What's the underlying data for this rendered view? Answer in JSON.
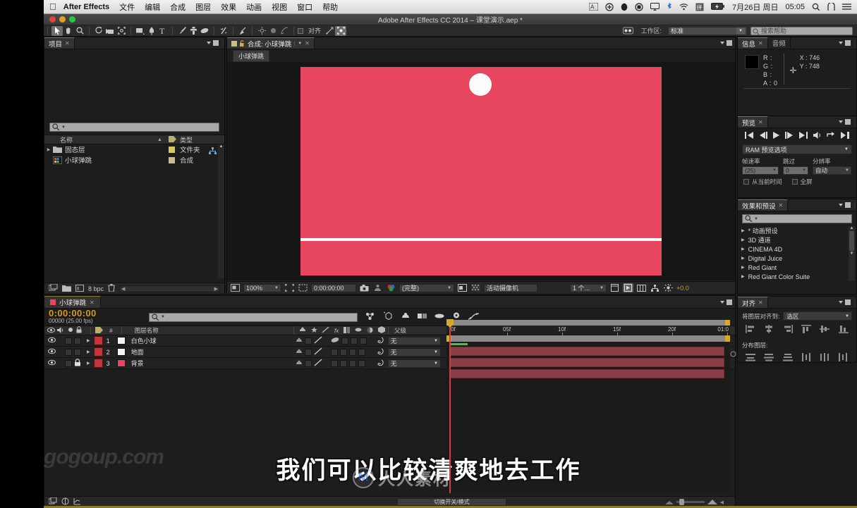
{
  "menubar": {
    "apple": "apple-logo",
    "app_name": "After Effects",
    "items": [
      "文件",
      "编辑",
      "合成",
      "图层",
      "效果",
      "动画",
      "视图",
      "窗口",
      "帮助"
    ],
    "status_icons": [
      "text-input-icon",
      "plus-circle-icon",
      "qq-icon",
      "record-icon",
      "airplay-icon",
      "bluetooth-icon",
      "wifi-icon",
      "input-source-icon",
      "battery-icon"
    ],
    "date": "7月26日 周日",
    "time": "05:05",
    "search_icon": "search-icon",
    "notification_icon": "notification-center-icon"
  },
  "titlebar": {
    "title": "Adobe After Effects CC 2014 – 课堂演示.aep *"
  },
  "toolbar": {
    "tools": [
      "selection-tool",
      "hand-tool",
      "zoom-tool",
      "rotation-tool",
      "camera-tool",
      "pan-behind-tool",
      "shape-tool",
      "pen-tool",
      "text-tool",
      "brush-tool",
      "clone-stamp-tool",
      "eraser-tool",
      "roto-brush-tool",
      "puppet-pin-tool"
    ],
    "align_label": "对齐",
    "workspace_label": "工作区:",
    "workspace_value": "标准",
    "help_placeholder": "搜索帮助"
  },
  "project": {
    "tab": "项目",
    "search_placeholder": "",
    "columns": {
      "name": "名称",
      "type": "类型"
    },
    "rows": [
      {
        "name": "固态层",
        "type": "文件夹",
        "swatch": "#d8cb5a",
        "icon": "folder-icon",
        "twirl": true
      },
      {
        "name": "小球弹跳",
        "type": "合成",
        "swatch": "#c8bb8c",
        "icon": "composition-icon",
        "twirl": false
      }
    ],
    "footer": {
      "bpc": "8 bpc"
    }
  },
  "composition": {
    "tab": "合成: 小球弹跳",
    "breadcrumb": "小球弹跳",
    "canvas": {
      "bg_color": "#e8455f",
      "ball_color": "#fbfbfb",
      "ground_color": "#fdfdfd"
    },
    "footer": {
      "zoom": "100%",
      "timecode": "0:00:00:00",
      "quality": "(完整)",
      "view": "活动摄像机",
      "views": "1 个...",
      "exposure": "+0.0"
    }
  },
  "info": {
    "tabs": [
      "信息",
      "音频"
    ],
    "channels": [
      "R :",
      "G :",
      "B :",
      "A : 0"
    ],
    "x": "X : 746",
    "y": "Y : 748",
    "swatch_color": "#000000"
  },
  "preview": {
    "tab": "预览",
    "buttons": [
      "first-frame-icon",
      "prev-frame-icon",
      "play-icon",
      "next-frame-icon",
      "last-frame-icon",
      "audio-icon",
      "loop-icon",
      "ram-preview-icon"
    ],
    "ram_option": "RAM 预览选项",
    "framerate_label": "帧速率",
    "framerate_value": "(25)",
    "skip_label": "跳过",
    "skip_value": "0",
    "resolution_label": "分辨率",
    "resolution_value": "自动",
    "from_current_time": "从当前时间",
    "fullscreen": "全屏"
  },
  "effects": {
    "tab": "效果和预设",
    "search_placeholder": "",
    "items": [
      "* 动画预设",
      "3D 通道",
      "CINEMA 4D",
      "Digital Juice",
      "Red Giant",
      "Red Giant Color Suite"
    ]
  },
  "align": {
    "tab": "对齐",
    "align_label": "将图层对齐到:",
    "align_value": "选区",
    "distribute_label": "分布图层:",
    "align_icons": [
      "align-left-icon",
      "align-h-center-icon",
      "align-right-icon",
      "align-top-icon",
      "align-v-center-icon",
      "align-bottom-icon"
    ],
    "distribute_icons": [
      "dist-top-icon",
      "dist-v-center-icon",
      "dist-bottom-icon",
      "dist-left-icon",
      "dist-h-center-icon",
      "dist-right-icon"
    ]
  },
  "timeline": {
    "tab": "小球弹跳",
    "current_time": "0:00:00:00",
    "frame_info": "00000 (25.00 fps)",
    "search_placeholder": "",
    "columns": {
      "num": "#",
      "layer_name": "图层名称",
      "parent": "父级"
    },
    "layers": [
      {
        "index": "1",
        "name": "白色小球",
        "color": "#c4363c",
        "thumb": "#f2f2f2",
        "locked": false,
        "parent": "无"
      },
      {
        "index": "2",
        "name": "地面",
        "color": "#c4363c",
        "thumb": "#f2f2f2",
        "locked": false,
        "parent": "无"
      },
      {
        "index": "3",
        "name": "背景",
        "color": "#c4363c",
        "thumb": "#e8455f",
        "locked": true,
        "parent": "无"
      }
    ],
    "ruler_labels": [
      "0f",
      "05f",
      "10f",
      "15f",
      "20f",
      "01:0"
    ],
    "footer_toggle": "切换开关/模式"
  },
  "overlay": {
    "watermark_left": "gogoup.com",
    "subtitle": "我们可以比较清爽地去工作",
    "watermark_center_logo": "M",
    "watermark_center_text": "人人素材"
  }
}
